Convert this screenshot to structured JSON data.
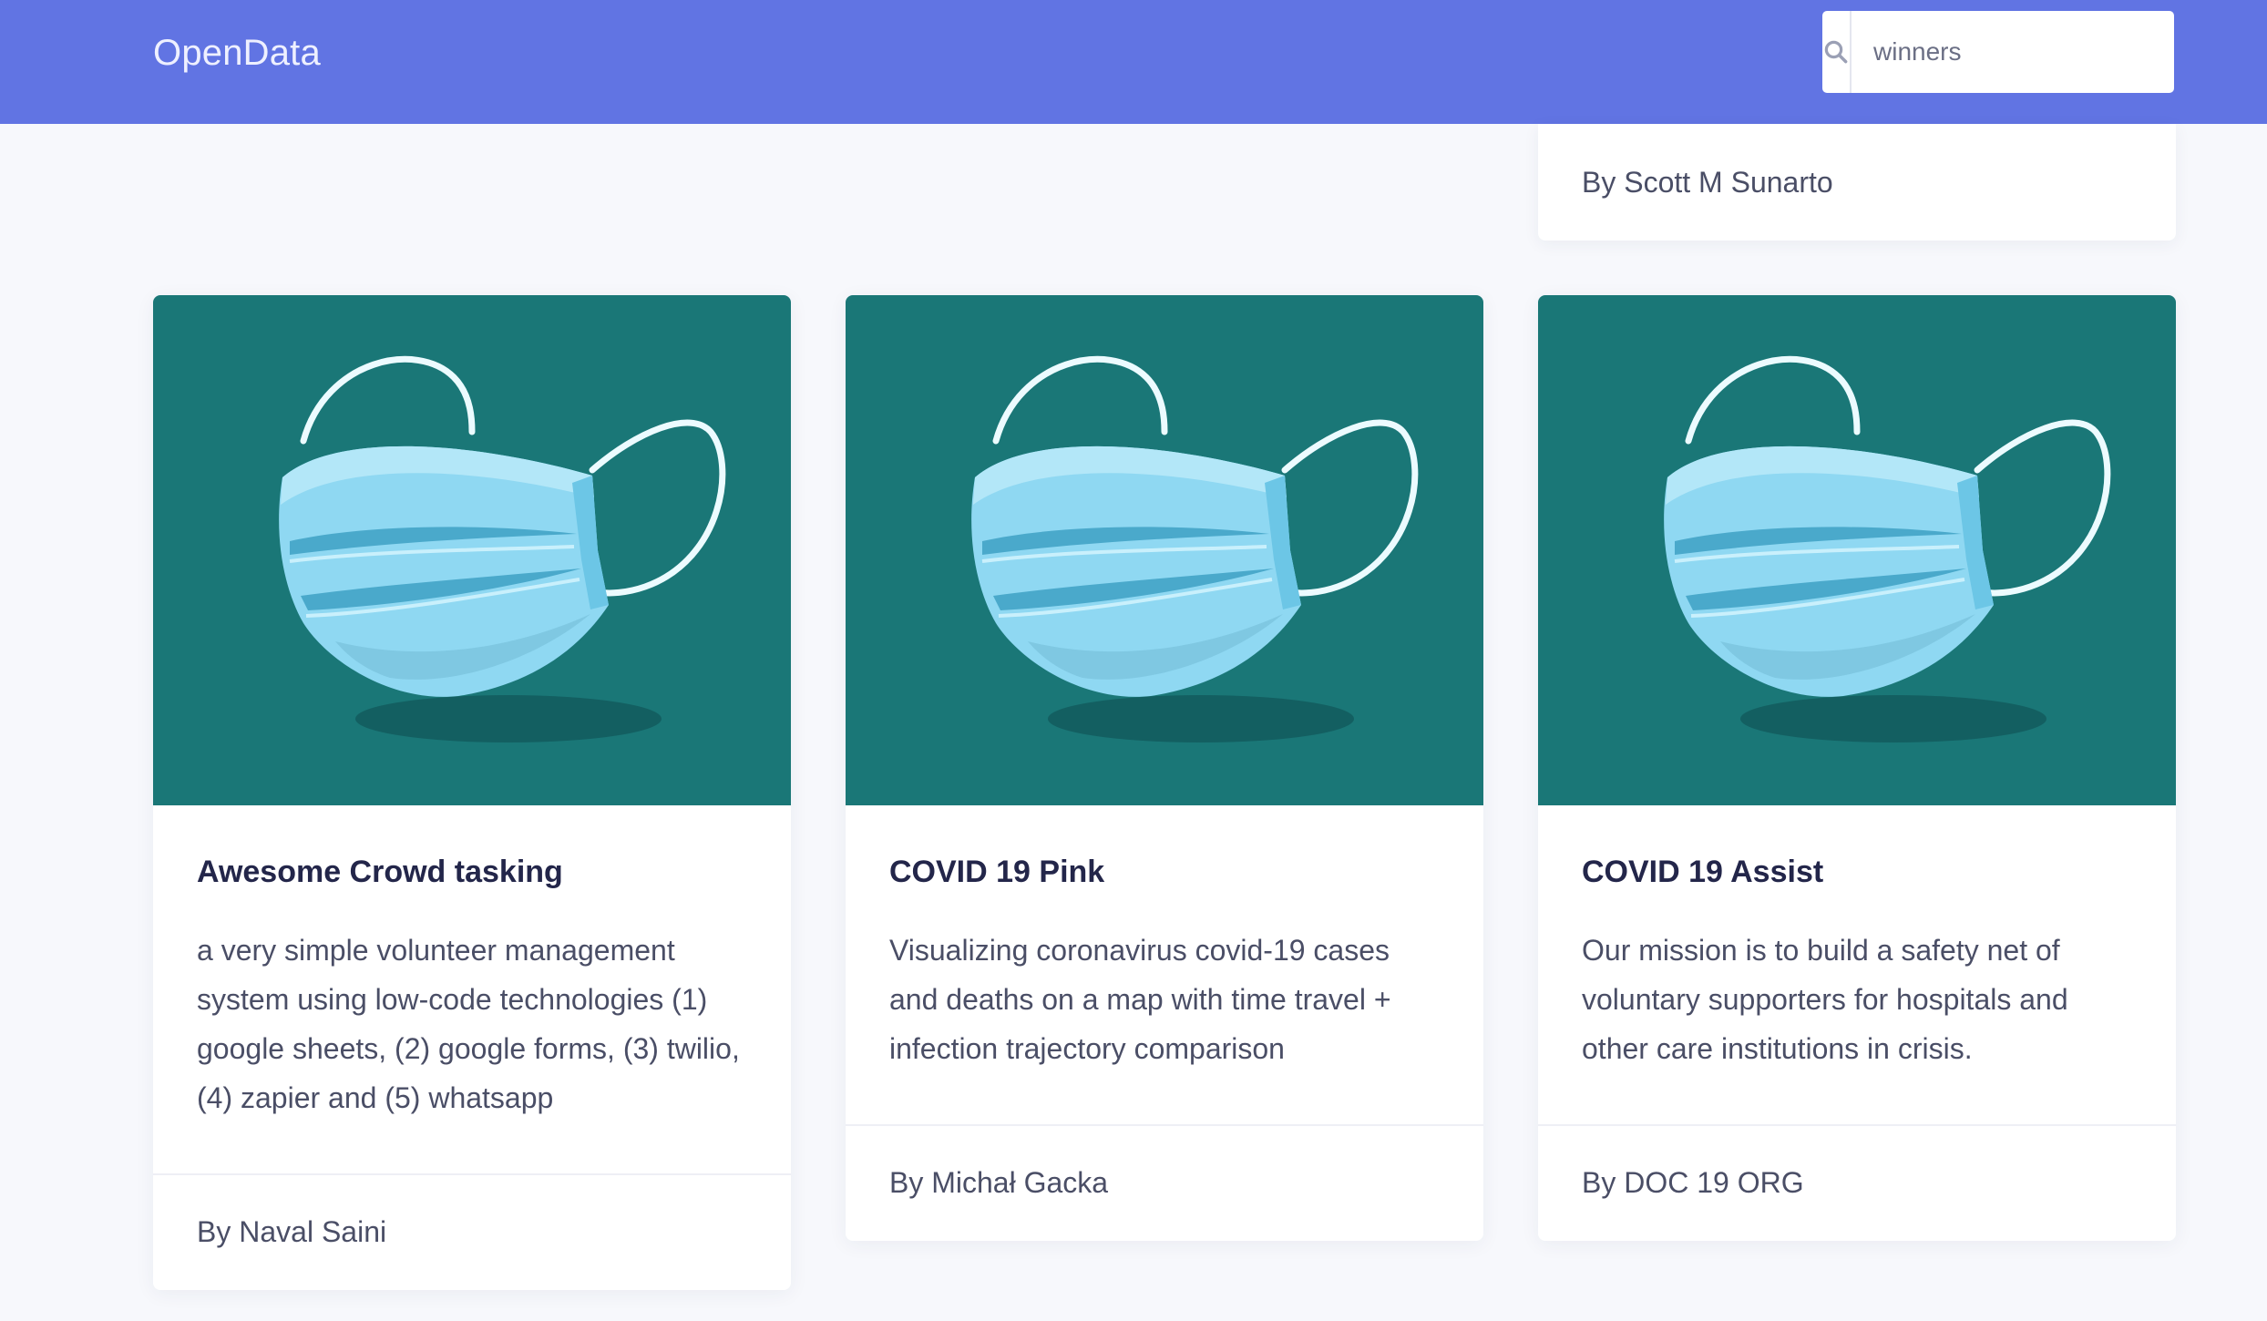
{
  "header": {
    "brand": "OpenData",
    "search": {
      "value": "winners",
      "icon": "search-icon"
    }
  },
  "partial_card": {
    "author": "By Scott M Sunarto"
  },
  "cards": [
    {
      "image_icon": "face-mask-illustration",
      "title": "Awesome Crowd tasking",
      "description": "a very simple volunteer management system using low-code technologies (1) google sheets, (2) google forms, (3) twilio, (4) zapier and (5) whatsapp",
      "author": "By Naval Saini"
    },
    {
      "image_icon": "face-mask-illustration",
      "title": "COVID 19 Pink",
      "description": "Visualizing coronavirus covid-19 cases and deaths on a map with time travel + infection trajectory comparison",
      "author": "By Michał Gacka"
    },
    {
      "image_icon": "face-mask-illustration",
      "title": "COVID 19 Assist",
      "description": "Our mission is to build a safety net of voluntary supporters for hospitals and other care institutions in crisis.",
      "author": "By DOC 19 ORG"
    }
  ],
  "colors": {
    "navbar": "#6174e3",
    "card_image_bg": "#1a7777",
    "mask": "#8fd8f2",
    "page_bg": "#f7f8fc"
  }
}
